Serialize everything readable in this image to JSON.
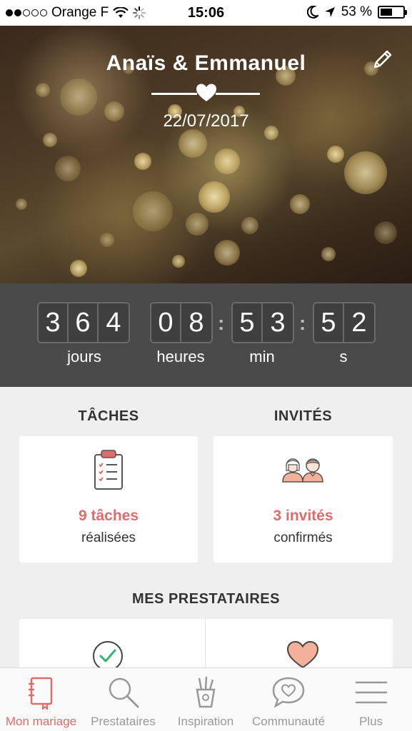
{
  "status_bar": {
    "carrier": "Orange F",
    "time": "15:06",
    "battery_percent": "53 %",
    "battery_level": 0.53,
    "signal_bars_filled": 2,
    "signal_bars_total": 5
  },
  "hero": {
    "couple_names": "Anaïs & Emmanuel",
    "wedding_date": "22/07/2017"
  },
  "countdown": {
    "days": [
      "3",
      "6",
      "4"
    ],
    "hours": [
      "0",
      "8"
    ],
    "minutes": [
      "5",
      "3"
    ],
    "seconds": [
      "5",
      "2"
    ],
    "separator": ":",
    "labels": {
      "days": "jours",
      "hours": "heures",
      "minutes": "min",
      "seconds": "s"
    }
  },
  "tasks": {
    "title": "TÂCHES",
    "count_text": "9 tâches",
    "sub_text": "réalisées",
    "icon": "clipboard-checklist-icon"
  },
  "guests": {
    "title": "INVITÉS",
    "count_text": "3 invités",
    "sub_text": "confirmés",
    "icon": "couple-avatars-icon"
  },
  "vendors": {
    "title": "MES PRESTATAIRES",
    "left_icon": "check-circle-icon",
    "right_icon": "heart-icon"
  },
  "tabbar": {
    "items": [
      {
        "label": "Mon mariage",
        "icon": "notebook-icon",
        "active": true
      },
      {
        "label": "Prestataires",
        "icon": "search-icon",
        "active": false
      },
      {
        "label": "Inspiration",
        "icon": "pencil-cup-icon",
        "active": false
      },
      {
        "label": "Communauté",
        "icon": "chat-heart-icon",
        "active": false
      },
      {
        "label": "Plus",
        "icon": "menu-icon",
        "active": false
      }
    ]
  },
  "colors": {
    "accent": "#e06b6b",
    "countdown_bg": "#4a4a4a",
    "page_bg": "#efefef",
    "check_green": "#2eb872",
    "heart_peach": "#f4b199"
  }
}
